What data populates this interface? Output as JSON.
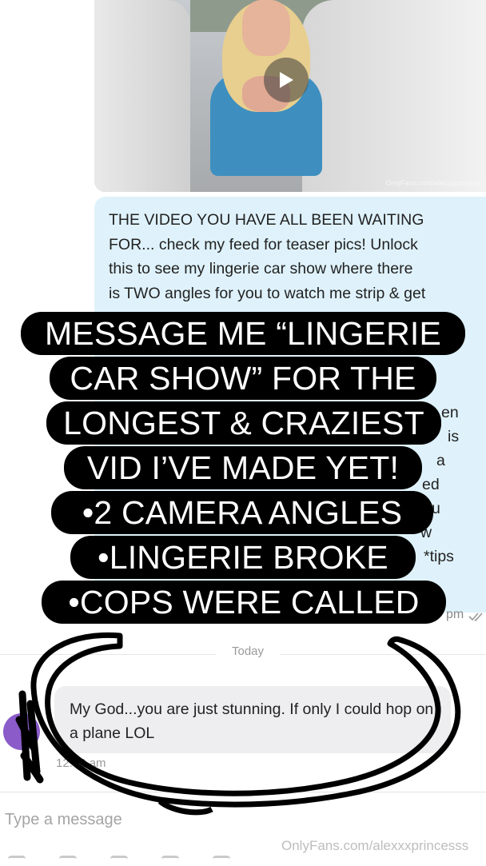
{
  "media": {
    "watermark": "OnlyFans.com/alexxxprincess",
    "play_icon": "play-icon"
  },
  "incoming": {
    "lines": [
      "THE VIDEO YOU HAVE ALL BEEN WAITING",
      "FOR... check my feed for teaser pics! Unlock",
      "this to see my lingerie car show where there",
      "is TWO angles for you to watch me strip & get"
    ],
    "peek_en": "en",
    "peek_is": "is",
    "peek_a": "a",
    "peek_ed": "ed",
    "peek_u": "u",
    "peek_w": "w",
    "peek_tips": "*tips",
    "time_partial": "pm",
    "read_icon": "double-check-icon"
  },
  "overlay": {
    "lines": [
      "MESSAGE ME “LINGERIE",
      "CAR SHOW” FOR THE",
      "LONGEST & CRAZIEST",
      "VID I’VE MADE YET!",
      "•2 CAMERA ANGLES",
      "•LINGERIE BROKE",
      "•COPS WERE CALLED"
    ]
  },
  "date_divider": "Today",
  "outgoing": {
    "text": "My God...you are just stunning. If only I could hop on a plane LOL",
    "time": "12:49 am"
  },
  "composer": {
    "placeholder": "Type a message"
  },
  "footer_watermark": "OnlyFans.com/alexxxprincesss",
  "colors": {
    "incoming_bubble": "#dff2fb",
    "outgoing_bubble": "#eeeef0",
    "overlay_bg": "#000000",
    "avatar": "#8a5bc9"
  }
}
